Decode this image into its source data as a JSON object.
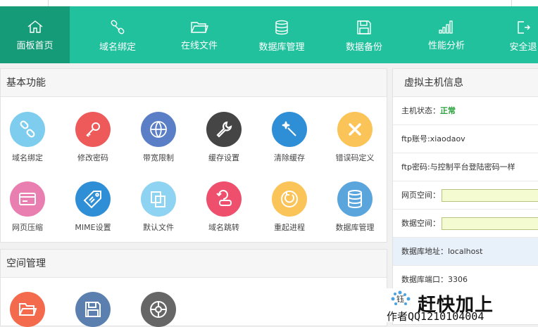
{
  "nav": {
    "items": [
      {
        "label": "面板首页",
        "icon": "home-icon"
      },
      {
        "label": "域名绑定",
        "icon": "link-icon"
      },
      {
        "label": "在线文件",
        "icon": "folder-icon"
      },
      {
        "label": "数据库管理",
        "icon": "database-icon"
      },
      {
        "label": "数据备份",
        "icon": "save-icon"
      },
      {
        "label": "性能分析",
        "icon": "bar-chart-icon"
      },
      {
        "label": "安全退",
        "icon": "exit-icon"
      }
    ]
  },
  "basic": {
    "title": "基本功能",
    "items": [
      {
        "label": "域名绑定",
        "color": "#7ecdef",
        "icon": "link-icon"
      },
      {
        "label": "修改密码",
        "color": "#ee5a5a",
        "icon": "key-icon"
      },
      {
        "label": "带宽限制",
        "color": "#5b7fc6",
        "icon": "globe-icon"
      },
      {
        "label": "缓存设置",
        "color": "#454545",
        "icon": "wrench-icon"
      },
      {
        "label": "清除缓存",
        "color": "#2f8fd6",
        "icon": "magic-wand-icon"
      },
      {
        "label": "错误码定义",
        "color": "#fbc459",
        "icon": "error-x-icon"
      },
      {
        "label": "网页压缩",
        "color": "#e97fb0",
        "icon": "card-icon"
      },
      {
        "label": "MIME设置",
        "color": "#2f8fd6",
        "icon": "tag-icon"
      },
      {
        "label": "默认文件",
        "color": "#8fd3f2",
        "icon": "files-icon"
      },
      {
        "label": "域名跳转",
        "color": "#ee4f6d",
        "icon": "redirect-icon"
      },
      {
        "label": "重起进程",
        "color": "#fbc459",
        "icon": "restart-icon"
      },
      {
        "label": "数据库管理",
        "color": "#5aa5dc",
        "icon": "database-icon"
      }
    ]
  },
  "space": {
    "title": "空间管理",
    "items": [
      {
        "color": "#f46a4c",
        "icon": "folder-icon"
      },
      {
        "color": "#5b80b0",
        "icon": "save-icon"
      },
      {
        "color": "#666666",
        "icon": "network-icon"
      }
    ]
  },
  "host": {
    "title": "虚拟主机信息",
    "status_label": "主机状态：",
    "status_value": "正常",
    "ftp_account": "ftp账号:xiaodaov",
    "ftp_password": "ftp密码:与控制平台登陆密码一样",
    "web_space_label": "网页空间：",
    "data_space_label": "数据空间：",
    "db_address": "数据库地址：localhost",
    "db_port": "数据库端口：3306"
  },
  "watermark": {
    "line1": "赶快加上",
    "line2": "作者QQ1210104004",
    "emblem": "钰"
  },
  "colors": {
    "nav_bg": "#20c19c",
    "nav_active": "#159b77",
    "status_ok": "#2aa33c"
  }
}
